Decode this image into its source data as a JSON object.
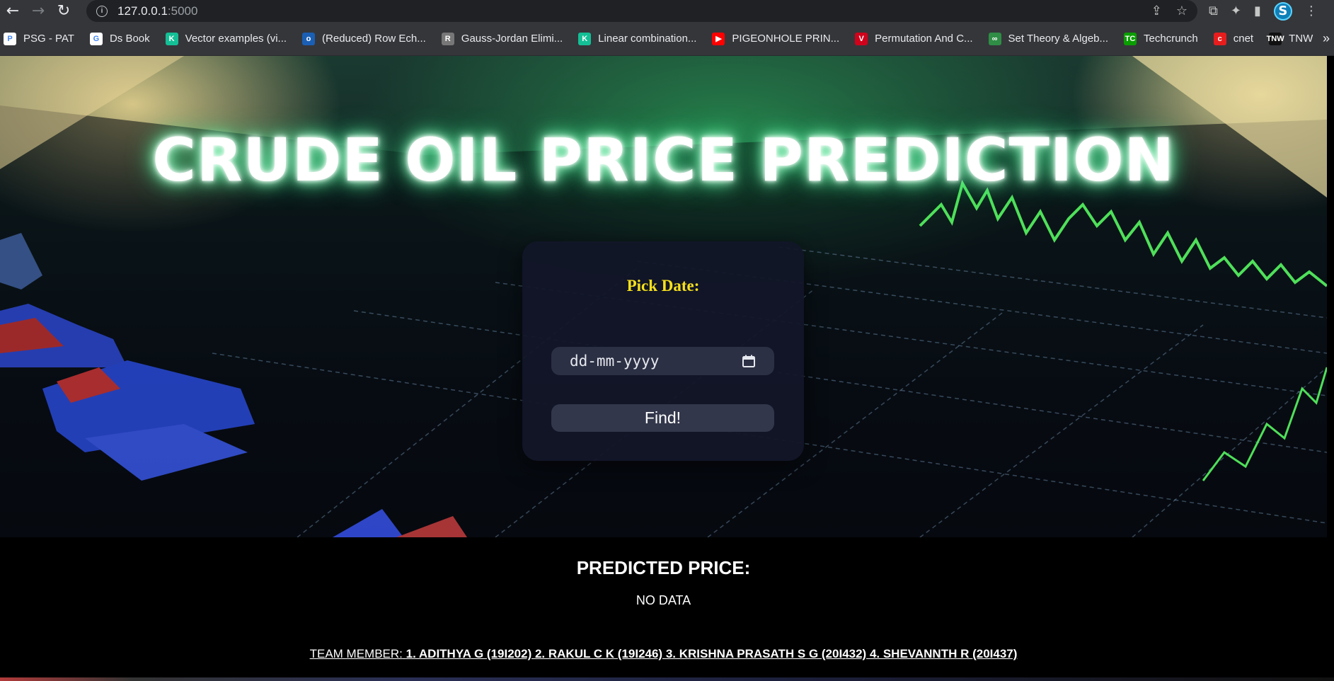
{
  "browser": {
    "url_host": "127.0.0.1",
    "url_port": ":5000",
    "icons": {
      "back": "back-arrow-icon",
      "forward": "forward-arrow-icon",
      "reload": "reload-icon",
      "share": "share-icon",
      "star": "bookmark-star-icon",
      "extensions": "puzzle-icon",
      "side_panel": "side-panel-icon",
      "profile": "S"
    },
    "bookmarks": [
      {
        "label": "PSG - PAT",
        "color": "#ffffff",
        "glyph": "P"
      },
      {
        "label": "Ds Book",
        "color": "#ffffff",
        "glyph": "G"
      },
      {
        "label": "Vector examples (vi...",
        "color": "#14bf96",
        "glyph": "K"
      },
      {
        "label": "(Reduced) Row Ech...",
        "color": "#1a5fb4",
        "glyph": "o"
      },
      {
        "label": "Gauss-Jordan Elimi...",
        "color": "#777777",
        "glyph": "R"
      },
      {
        "label": "Linear combination...",
        "color": "#14bf96",
        "glyph": "K"
      },
      {
        "label": "PIGEONHOLE PRIN...",
        "color": "#ff0000",
        "glyph": "▶"
      },
      {
        "label": "Permutation And C...",
        "color": "#d0021b",
        "glyph": "V"
      },
      {
        "label": "Set Theory & Algeb...",
        "color": "#2f8d46",
        "glyph": "∞"
      },
      {
        "label": "Techcrunch",
        "color": "#0a9e01",
        "glyph": "TC"
      },
      {
        "label": "cnet",
        "color": "#e71d1d",
        "glyph": "c"
      },
      {
        "label": "TNW",
        "color": "#111111",
        "glyph": "TNW"
      }
    ],
    "more_bookmarks": "»"
  },
  "page": {
    "title": "CRUDE OIL PRICE PREDICTION",
    "form": {
      "label": "Pick Date:",
      "date_placeholder": "dd-mm-yyyy",
      "calendar_icon": "calendar-icon",
      "button": "Find!"
    },
    "result": {
      "heading": "PREDICTED PRICE:",
      "value": "NO DATA"
    },
    "team": {
      "label": "TEAM MEMBER:",
      "members": "1. ADITHYA G (19I202) 2. RAKUL C K (19I246) 3. KRISHNA PRASATH S G (20I432) 4. SHEVANNTH R (20I437)"
    }
  },
  "colors": {
    "title_glow": "#2bd97a",
    "label_yellow": "#f7e11a",
    "card_bg": "#121628",
    "input_bg": "#2c3044"
  }
}
